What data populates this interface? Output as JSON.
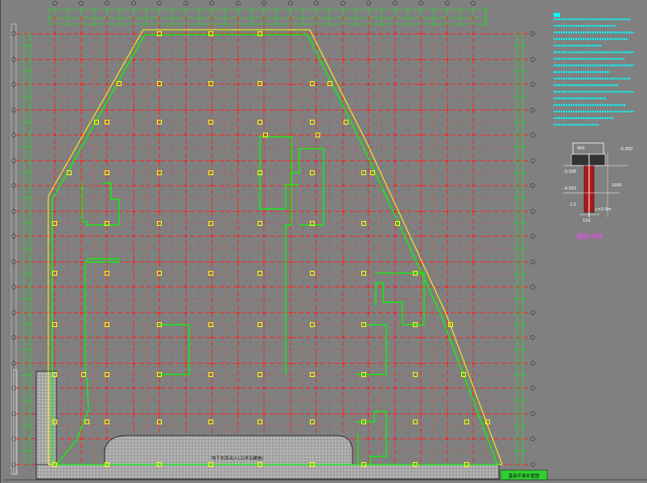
{
  "title_block": {
    "entrance_label": "地下车库出入口(详见建施)"
  },
  "detail": {
    "title": "锚杆大样",
    "elev_top": "-0.050",
    "elev_mid": "-3.500",
    "elev_bot": "-4.550",
    "dim_top": "400",
    "dim_side": "1000",
    "dim_bottom": "150",
    "pile_label": "1:5",
    "anchor_len": "L=2.5m"
  },
  "stamp": {
    "text": "基础平面布置图"
  },
  "colors": {
    "background": "#808080",
    "grid_red": "#ff2020",
    "outline_green": "#00ff00",
    "outline_yellow": "#ffff00",
    "anchor_square": "#ffff00",
    "note_cyan": "#00ffff"
  }
}
